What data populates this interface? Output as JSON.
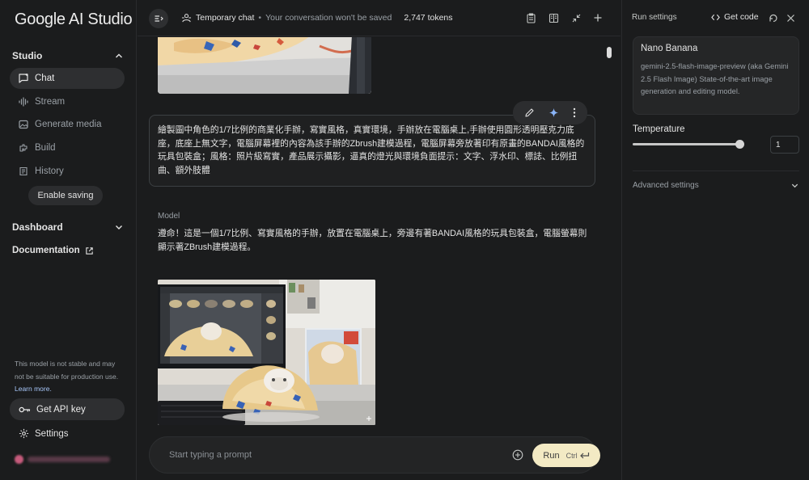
{
  "sidebar": {
    "logo": "Google AI Studio",
    "studio_label": "Studio",
    "items": [
      {
        "label": "Chat",
        "icon": "chat-icon"
      },
      {
        "label": "Stream",
        "icon": "stream-icon"
      },
      {
        "label": "Generate media",
        "icon": "media-icon"
      },
      {
        "label": "Build",
        "icon": "build-icon"
      },
      {
        "label": "History",
        "icon": "history-icon"
      }
    ],
    "enable_saving": "Enable saving",
    "dashboard_label": "Dashboard",
    "documentation_label": "Documentation",
    "model_note": "This model is not stable and may not be suitable for production use.",
    "learn_more": "Learn more.",
    "get_api_key": "Get API key",
    "settings_label": "Settings"
  },
  "topbar": {
    "title": "Temporary chat",
    "subtitle": "Your conversation won't be saved",
    "tokens": "2,747 tokens"
  },
  "chat": {
    "user_message": "繪製圖中角色的1/7比例的商業化手辦，寫實風格，真實環境，手辦放在電腦桌上,手辦使用圓形透明壓克力底座，底座上無文字，電腦屏幕裡的內容為該手辦的Zbrush建模過程，電腦屏幕旁放著印有原畫的BANDAI風格的玩具包裝盒；風格：照片級寫實，產品展示攝影，逼真的燈光與環境負面提示：文字、浮水印、標誌、比例扭曲、額外肢體",
    "model_label": "Model",
    "model_response": "遵命！這是一個1/7比例、寫實風格的手辦，放置在電腦桌上，旁邊有著BANDAI風格的玩具包裝盒，電腦螢幕則顯示著ZBrush建模過程。",
    "prompt_placeholder": "Start typing a prompt",
    "run_label": "Run",
    "run_shortcut": "Ctrl"
  },
  "run_settings": {
    "title": "Run settings",
    "get_code": "Get code",
    "model_name": "Nano Banana",
    "model_desc": "gemini-2.5-flash-image-preview (aka Gemini 2.5 Flash Image) State-of-the-art image generation and editing model.",
    "temperature_label": "Temperature",
    "temperature_value": "1",
    "temperature_fraction": 0.5,
    "advanced_label": "Advanced settings"
  },
  "colors": {
    "accent_run": "#f3eac4",
    "link": "#a8c7fa",
    "background": "#1b1c1d"
  }
}
